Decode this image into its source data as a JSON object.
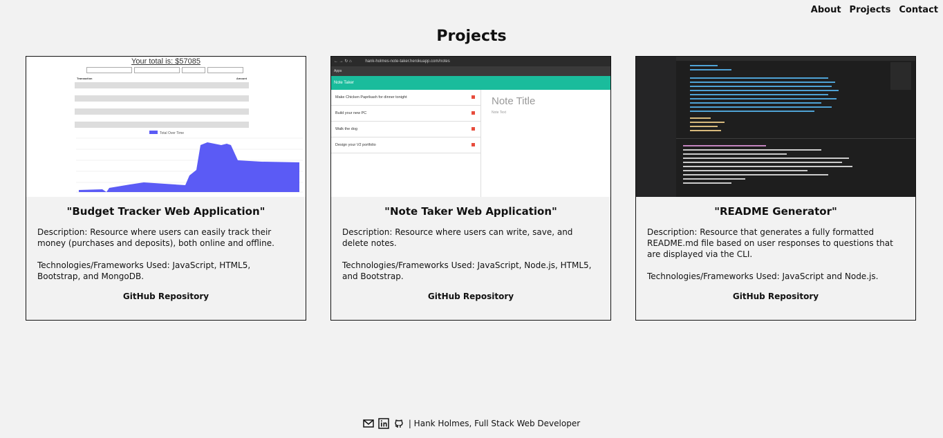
{
  "nav": {
    "about": "About",
    "projects": "Projects",
    "contact": "Contact"
  },
  "page_title": "Projects",
  "projects": [
    {
      "title": "\"Budget Tracker Web Application\"",
      "description": "Description: Resource where users can easily track their money (purchases and deposits), both online and offline.",
      "technologies": "Technologies/Frameworks Used: JavaScript, HTML5, Bootstrap, and MongoDB.",
      "repo_label": "GitHub Repository",
      "screenshot": {
        "total": "Your total is: $57085",
        "table_headers": [
          "Transaction",
          "Amount"
        ],
        "legend": "Total Over Time"
      }
    },
    {
      "title": "\"Note Taker Web Application\"",
      "description": "Description: Resource where users can write, save, and delete notes.",
      "technologies": "Technologies/Frameworks Used: JavaScript, Node.js, HTML5, and Bootstrap.",
      "repo_label": "GitHub Repository",
      "screenshot": {
        "url": "hank-holmes-note-taker.herokuapp.com/notes",
        "apps": "Apps",
        "app_title": "Note Taker",
        "notes": [
          "Make Chicken Paprikash for dinner tonight",
          "Build your new PC",
          "Walk the dog",
          "Design your V2 portfolio"
        ],
        "placeholder_title": "Note Title",
        "placeholder_text": "Note Text"
      }
    },
    {
      "title": "\"README Generator\"",
      "description": "Description: Resource that generates a fully formatted README.md file based on user responses to questions that are displayed via the CLI.",
      "technologies": "Technologies/Frameworks Used: JavaScript and Node.js.",
      "repo_label": "GitHub Repository"
    }
  ],
  "footer": {
    "icons": [
      "mail-icon",
      "linkedin-icon",
      "github-icon"
    ],
    "text": "| Hank Holmes, Full Stack Web Developer"
  },
  "colors": {
    "note_taker_accent": "#1abc9c",
    "chart_fill": "#5b5bf5"
  }
}
